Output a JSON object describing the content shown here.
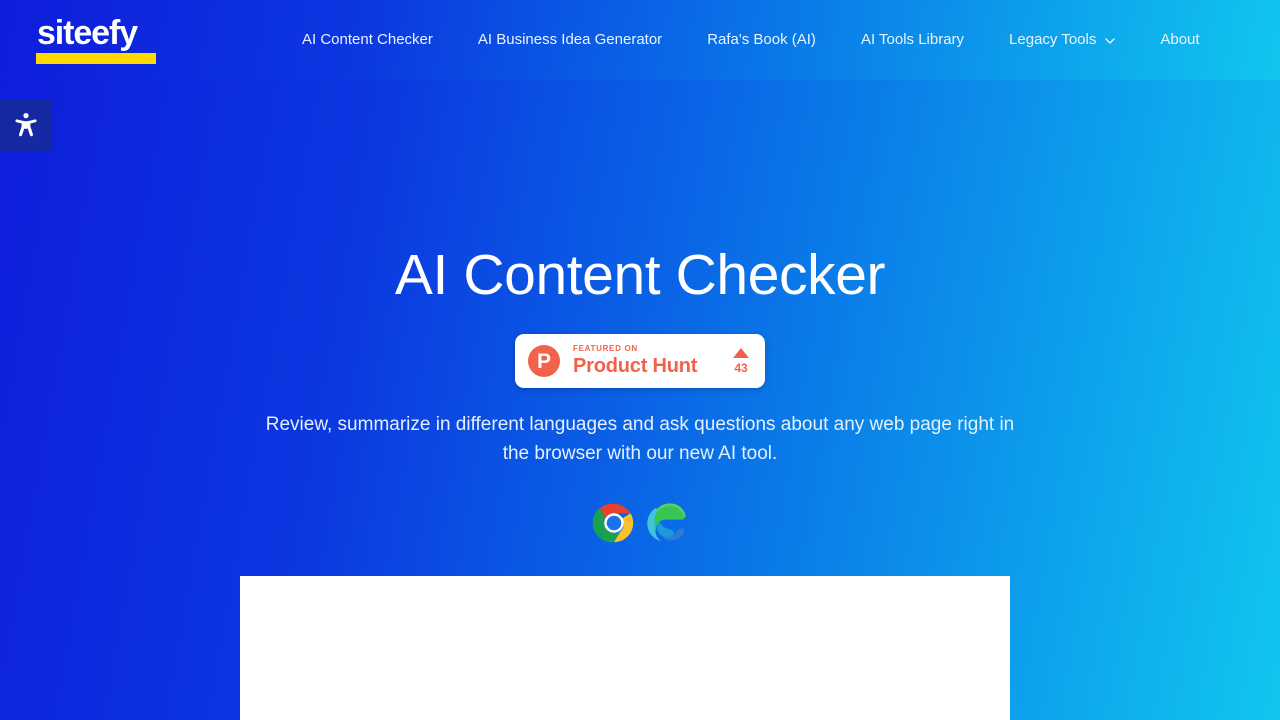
{
  "header": {
    "logo": {
      "text": "siteefy",
      "name": "siteefy-logo",
      "underline_color": "#ffd900"
    },
    "nav": [
      {
        "label": "AI Content Checker",
        "name": "nav-ai-content-checker",
        "has_dropdown": false
      },
      {
        "label": "AI Business Idea Generator",
        "name": "nav-ai-business-idea-generator",
        "has_dropdown": false
      },
      {
        "label": "Rafa's Book (AI)",
        "name": "nav-rafas-book-ai",
        "has_dropdown": false
      },
      {
        "label": "AI Tools Library",
        "name": "nav-ai-tools-library",
        "has_dropdown": false
      },
      {
        "label": "Legacy Tools",
        "name": "nav-legacy-tools",
        "has_dropdown": true
      },
      {
        "label": "About",
        "name": "nav-about",
        "has_dropdown": false
      }
    ]
  },
  "accessibility_widget": {
    "icon": "accessibility-person-icon",
    "label": "Open Accessibility Toolbar"
  },
  "hero": {
    "title": "AI Content Checker",
    "subtitle": "Review, summarize in different languages and ask questions about any web page right in the browser with our new AI tool.",
    "product_hunt_badge": {
      "logo_letter": "P",
      "kicker": "FEATURED ON",
      "name": "Product Hunt",
      "upvote_icon": "upvote-triangle-icon",
      "vote_count": "43",
      "accent_color": "#f2614b"
    },
    "browsers": [
      {
        "label": "Google Chrome",
        "name": "chrome-icon"
      },
      {
        "label": "Microsoft Edge",
        "name": "edge-icon"
      }
    ]
  },
  "content_panel": {
    "faint_text": ""
  },
  "theme": {
    "gradient_start": "#0f1ddb",
    "gradient_end": "#10c6ef",
    "logo_yellow": "#ffd900",
    "product_hunt_coral": "#f2614b"
  }
}
